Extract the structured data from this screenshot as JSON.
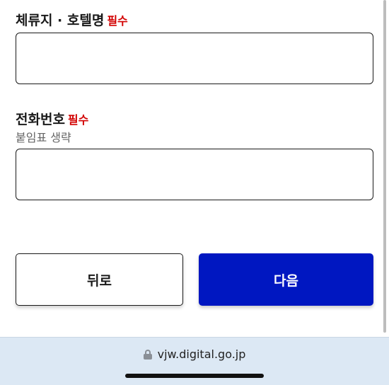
{
  "form": {
    "hotel": {
      "label": "체류지 · 호텔명",
      "required": "필수",
      "value": ""
    },
    "phone": {
      "label": "전화번호",
      "required": "필수",
      "hint": "붙임표 생략",
      "value": ""
    }
  },
  "buttons": {
    "back": "뒤로",
    "next": "다음"
  },
  "browser": {
    "url": "vjw.digital.go.jp"
  },
  "colors": {
    "primary": "#0017c1",
    "required": "#d20000",
    "browser_bar": "#dce8f4"
  }
}
